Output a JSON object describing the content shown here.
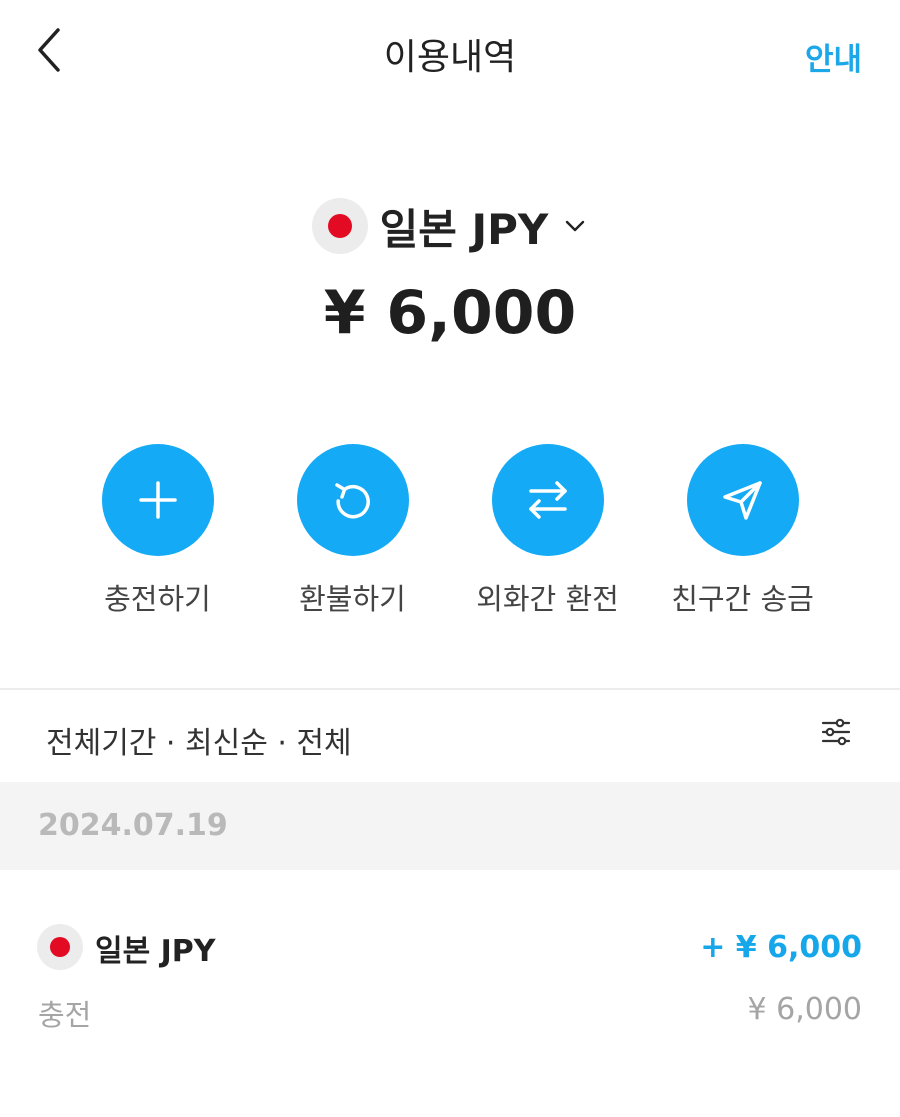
{
  "header": {
    "title": "이용내역",
    "guide_label": "안내"
  },
  "currency": {
    "name": "일본 JPY",
    "balance": "¥ 6,000",
    "flag_color": "#e30a24"
  },
  "actions": [
    {
      "label": "충전하기",
      "icon": "plus-icon"
    },
    {
      "label": "환불하기",
      "icon": "refund-icon"
    },
    {
      "label": "외화간 환전",
      "icon": "exchange-icon"
    },
    {
      "label": "친구간 송금",
      "icon": "send-icon"
    }
  ],
  "filter": {
    "text": "전체기간 · 최신순 · 전체",
    "icon": "filter-sliders-icon"
  },
  "transactions": {
    "date": "2024.07.19",
    "items": [
      {
        "currency": "일본 JPY",
        "amount": "+ ¥ 6,000",
        "type": "충전",
        "sub_amount": "¥ 6,000"
      }
    ]
  },
  "colors": {
    "accent": "#14aaf5",
    "link": "#1ba7e8",
    "amount_positive": "#16a7ea",
    "date_band": "#f4f4f4"
  }
}
